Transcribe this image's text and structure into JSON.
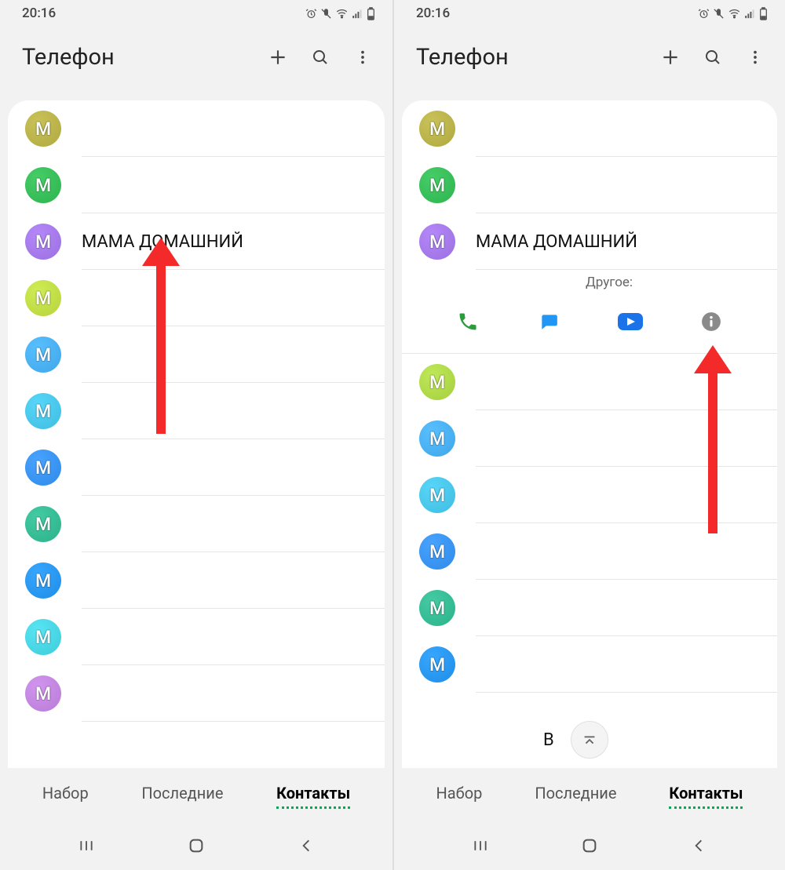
{
  "status": {
    "time": "20:16"
  },
  "header": {
    "title": "Телефон",
    "add_icon": "plus-icon",
    "search_icon": "search-icon",
    "menu_icon": "more-icon"
  },
  "contacts_left": [
    {
      "letter": "M",
      "color": "#b0a93f",
      "name": ""
    },
    {
      "letter": "M",
      "color": "#2db44e",
      "name": ""
    },
    {
      "letter": "M",
      "color": "#9b6fe0",
      "name": "МАМА ДОМАШНИЙ"
    },
    {
      "letter": "M",
      "color": "#b7d33c",
      "name": ""
    },
    {
      "letter": "M",
      "color": "#3fa6e8",
      "name": ""
    },
    {
      "letter": "M",
      "color": "#3ebde0",
      "name": ""
    },
    {
      "letter": "M",
      "color": "#2f8ae8",
      "name": ""
    },
    {
      "letter": "M",
      "color": "#2bb28a",
      "name": ""
    },
    {
      "letter": "M",
      "color": "#1e8de6",
      "name": ""
    },
    {
      "letter": "M",
      "color": "#3eccdb",
      "name": ""
    },
    {
      "letter": "M",
      "color": "#b87cd6",
      "name": ""
    }
  ],
  "contacts_right": [
    {
      "letter": "M",
      "color": "#b0a93f",
      "name": ""
    },
    {
      "letter": "M",
      "color": "#2db44e",
      "name": ""
    },
    {
      "letter": "M",
      "color": "#9b6fe0",
      "name": "МАМА ДОМАШНИЙ"
    }
  ],
  "expanded": {
    "subtitle": "Другое:",
    "actions": [
      "call",
      "message",
      "video",
      "info"
    ]
  },
  "contacts_right_after": [
    {
      "letter": "M",
      "color": "#a6cf3f",
      "name": ""
    },
    {
      "letter": "M",
      "color": "#3fa6e8",
      "name": ""
    },
    {
      "letter": "M",
      "color": "#3ebde0",
      "name": ""
    },
    {
      "letter": "M",
      "color": "#2f8ae8",
      "name": ""
    },
    {
      "letter": "M",
      "color": "#2bb28a",
      "name": ""
    },
    {
      "letter": "M",
      "color": "#1e8de6",
      "name": ""
    }
  ],
  "fab_partial_text": "В",
  "tabs": {
    "items": [
      "Набор",
      "Последние",
      "Контакты"
    ],
    "active_index": 2
  },
  "colors": {
    "call": "#2a9d3a",
    "message": "#2196f3",
    "video": "#1a73e8",
    "info": "#8a8a8a",
    "arrow": "#f42a2a"
  }
}
